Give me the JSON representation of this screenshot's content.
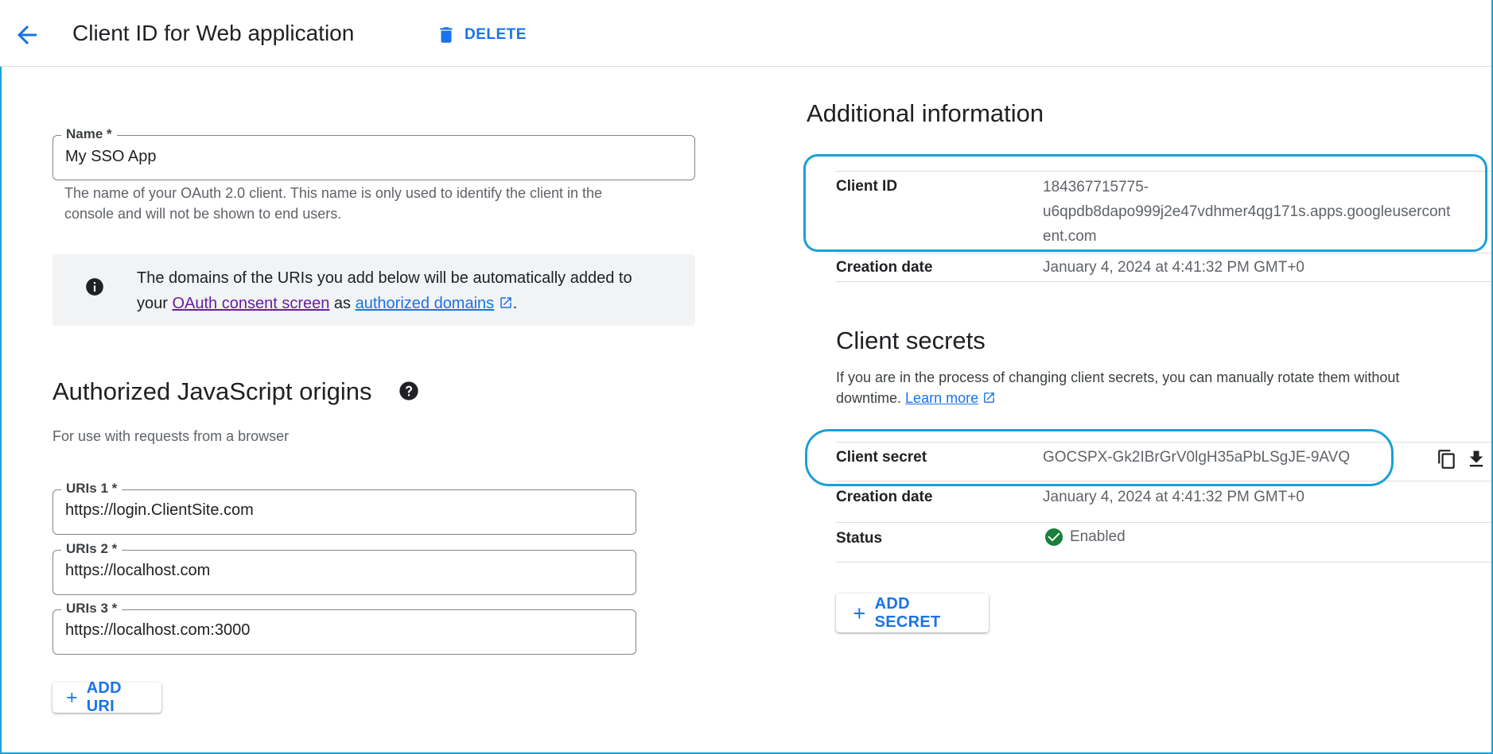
{
  "header": {
    "title": "Client ID for Web application",
    "delete_label": "DELETE"
  },
  "name_field": {
    "label": "Name *",
    "value": "My SSO App",
    "helper_line1": "The name of your OAuth 2.0 client. This name is only used to identify the client in the",
    "helper_line2": "console and will not be shown to end users."
  },
  "info_box": {
    "text_start": "The domains of the URIs you add below will be automatically added to",
    "text_your": "your ",
    "consent_link": "OAuth consent screen",
    "text_as": " as ",
    "domains_link": "authorized domains",
    "text_end": "."
  },
  "js_origins": {
    "title": "Authorized JavaScript origins",
    "subtitle": "For use with requests from a browser",
    "uris": [
      {
        "label": "URIs 1 *",
        "value": "https://login.ClientSite.com"
      },
      {
        "label": "URIs 2 *",
        "value": "https://localhost.com"
      },
      {
        "label": "URIs 3 *",
        "value": "https://localhost.com:3000"
      }
    ],
    "add_uri_label": "ADD URI"
  },
  "additional_info": {
    "title": "Additional information",
    "client_id_label": "Client ID",
    "client_id_line1": "184367715775-",
    "client_id_line2": "u6qpdb8dapo999j2e47vdhmer4qg171s.apps.googleusercont",
    "client_id_line3": "ent.com",
    "creation_date_label": "Creation date",
    "creation_date_value": "January 4, 2024 at 4:41:32 PM GMT+0"
  },
  "client_secrets": {
    "title": "Client secrets",
    "desc_line1": "If you are in the process of changing client secrets, you can manually rotate them without",
    "desc_line2": "downtime. ",
    "learn_more": "Learn more",
    "secret_label": "Client secret",
    "secret_value": "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",
    "creation_date_label": "Creation date",
    "creation_date_value": "January 4, 2024 at 4:41:32 PM GMT+0",
    "status_label": "Status",
    "status_value": "Enabled",
    "add_secret_label": "ADD SECRET"
  },
  "colors": {
    "accent": "#1a73e8",
    "highlight": "#1aa0d8",
    "enabled": "#188038",
    "visited_link": "#681da8"
  },
  "icons": [
    "arrow-back-icon",
    "trash-icon",
    "info-icon",
    "help-icon",
    "plus-icon",
    "external-link-icon",
    "copy-icon",
    "download-icon",
    "check-circle-icon"
  ]
}
